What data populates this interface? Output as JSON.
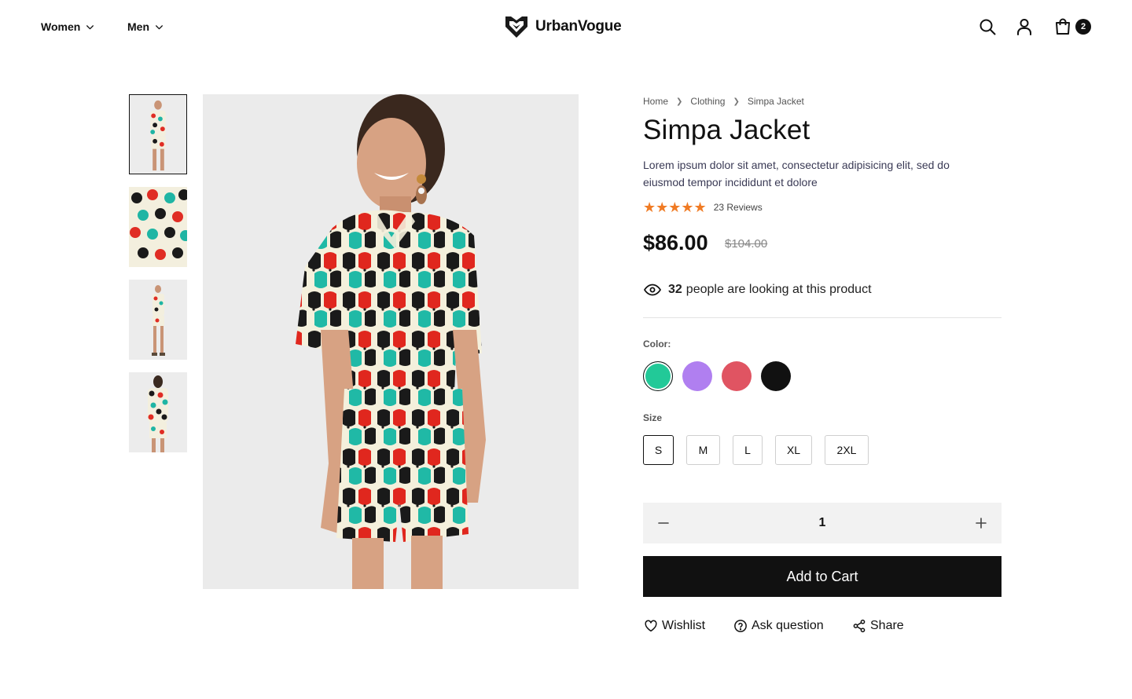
{
  "header": {
    "nav": [
      {
        "label": "Women"
      },
      {
        "label": "Men"
      }
    ],
    "brand": "UrbanVogue",
    "cart_count": "2",
    "icons": [
      "search-icon",
      "user-icon",
      "cart-icon",
      "chevron-down-icon"
    ]
  },
  "gallery": {
    "thumbnails": 4,
    "selected_index": 0
  },
  "product": {
    "breadcrumb": [
      "Home",
      "Clothing",
      "Simpa Jacket"
    ],
    "title": "Simpa Jacket",
    "description": "Lorem ipsum dolor sit amet, consectetur adipisicing elit, sed do eiusmod tempor incididunt et dolore",
    "rating": 5,
    "stars": "★★★★★",
    "reviews": "23 Reviews",
    "price": "$86.00",
    "old_price": "$104.00",
    "viewers_count": "32",
    "viewers_text": "people are looking at this product",
    "color_label": "Color:",
    "colors": [
      "#22c998",
      "#b07ff0",
      "#e05462",
      "#111111"
    ],
    "selected_color_index": 0,
    "size_label": "Size",
    "sizes": [
      "S",
      "M",
      "L",
      "XL",
      "2XL"
    ],
    "selected_size": "S",
    "quantity": "1",
    "add_to_cart": "Add to Cart",
    "actions": {
      "wishlist": "Wishlist",
      "ask": "Ask question",
      "share": "Share"
    }
  }
}
